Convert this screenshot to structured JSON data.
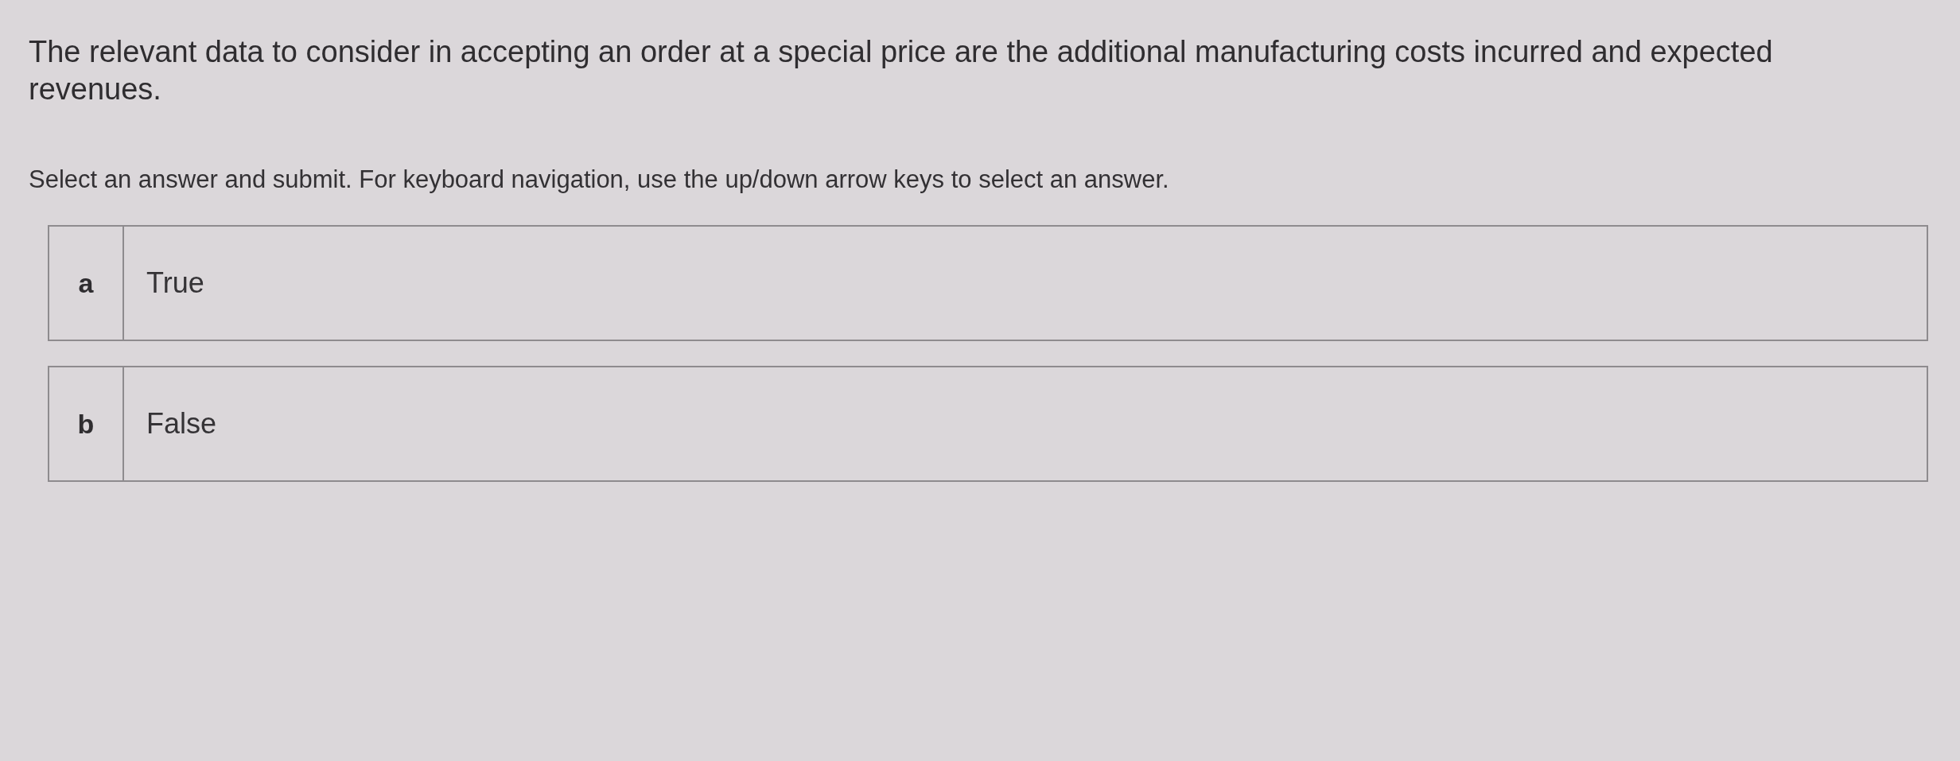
{
  "question": {
    "text": "The relevant data to consider in accepting an order at a special price are the additional manufacturing costs incurred and expected revenues."
  },
  "instructions": "Select an answer and submit. For keyboard navigation, use the up/down arrow keys to select an answer.",
  "options": [
    {
      "letter": "a",
      "label": "True",
      "selected": false
    },
    {
      "letter": "b",
      "label": "False",
      "selected": false
    }
  ]
}
